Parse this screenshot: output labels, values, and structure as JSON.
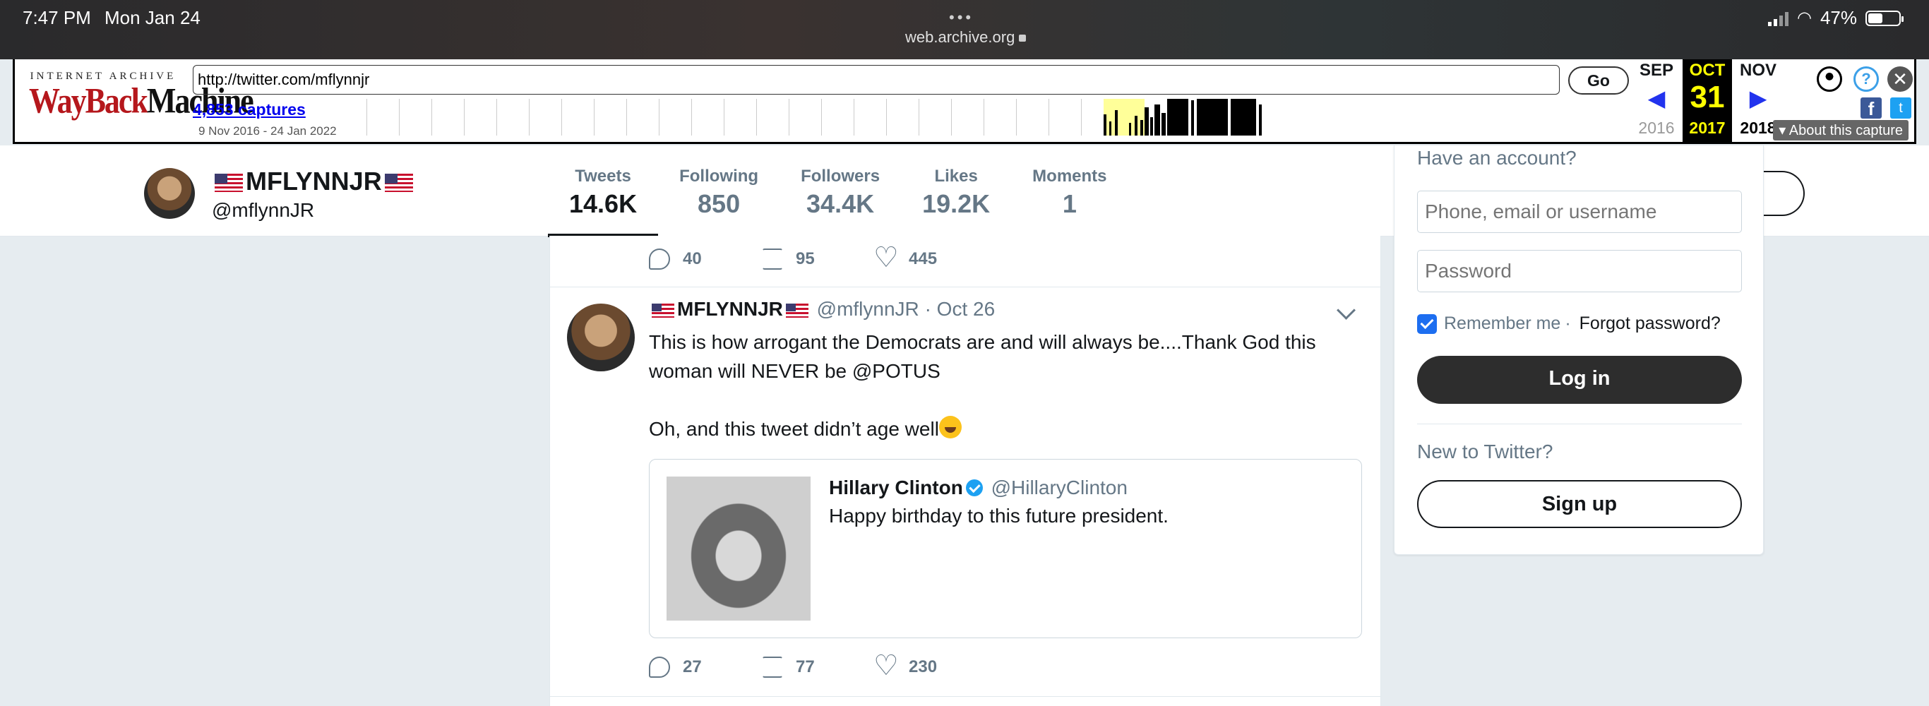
{
  "status_bar": {
    "time": "7:47 PM",
    "date": "Mon Jan 24",
    "url": "web.archive.org",
    "battery": "47%",
    "battery_level": 0.47
  },
  "wayback": {
    "logo_top": "INTERNET ARCHIVE",
    "logo_main_red": "WayBack",
    "logo_main_black": "Machine",
    "url_value": "http://twitter.com/mflynnjr",
    "go_label": "Go",
    "captures_link": "4,853 captures",
    "date_range": "9 Nov 2016 - 24 Jan 2022",
    "calendar": {
      "prev_month": "SEP",
      "cur_month": "OCT",
      "next_month": "NOV",
      "cur_day": "31",
      "prev_year": "2016",
      "cur_year": "2017",
      "next_year": "2018"
    },
    "about_capture": "About this capture",
    "colors": {
      "logo_red": "#b5171c",
      "calendar_highlight": "#ffff00",
      "arrow_blue": "#2233ee"
    }
  },
  "profile": {
    "name": "MFLYNNJR",
    "handle": "@mflynnJR",
    "stats": [
      {
        "label": "Tweets",
        "value": "14.6K",
        "active": true
      },
      {
        "label": "Following",
        "value": "850"
      },
      {
        "label": "Followers",
        "value": "34.4K"
      },
      {
        "label": "Likes",
        "value": "19.2K"
      },
      {
        "label": "Moments",
        "value": "1"
      }
    ]
  },
  "timeline": {
    "prev_tweet_actions": {
      "replies": "40",
      "retweets": "95",
      "likes": "445"
    },
    "tweet": {
      "name": "MFLYNNJR",
      "handle": "@mflynnJR",
      "date": "Oct 26",
      "text_line1": "This is how arrogant the Democrats are and will always be....Thank God this woman will NEVER be @POTUS",
      "text_line2": "Oh, and this tweet didn’t age well",
      "quoted": {
        "name": "Hillary Clinton",
        "handle": "@HillaryClinton",
        "text": "Happy birthday to this future president."
      },
      "actions": {
        "replies": "27",
        "retweets": "77",
        "likes": "230"
      }
    }
  },
  "login": {
    "have_account": "Have an account?",
    "username_placeholder": "Phone, email or username",
    "password_placeholder": "Password",
    "remember_me": "Remember me",
    "separator": "·",
    "forgot_password": "Forgot password?",
    "login_label": "Log in",
    "new_to_twitter": "New to Twitter?",
    "signup_label": "Sign up"
  }
}
